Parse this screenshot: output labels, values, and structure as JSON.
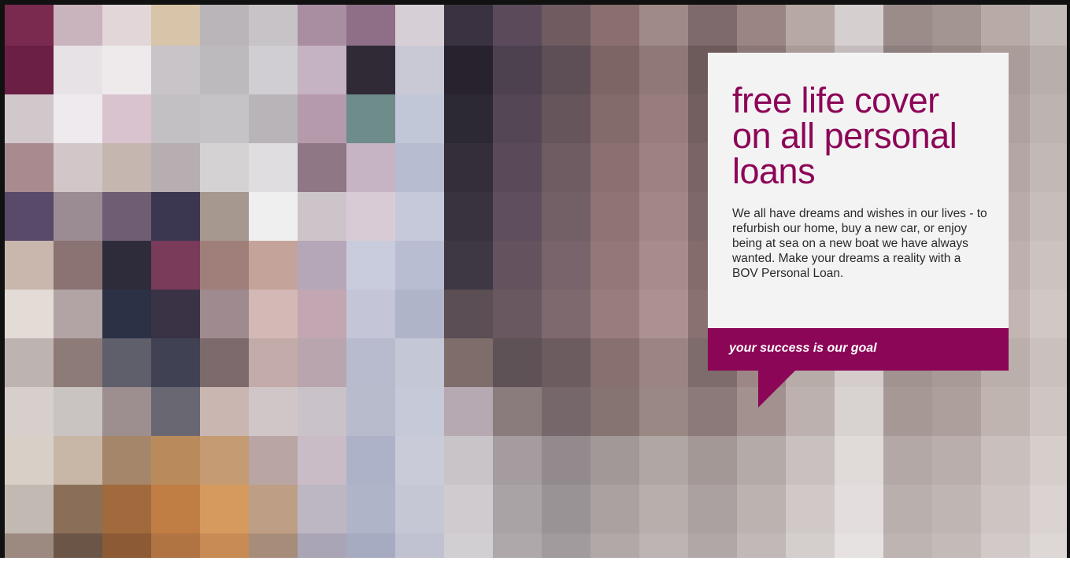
{
  "promo": {
    "headline": "free life cover on all personal loans",
    "body": "We all have dreams and wishes in our lives - to refurbish our home, buy a new car, or enjoy being at sea on a new boat we have always wanted. Make your dreams a reality with a BOV Personal Loan.",
    "tagline": "your success is our goal"
  },
  "colors": {
    "brand": "#8c0657",
    "card_background": "#f4f3f4",
    "body_text": "#2b2b2b",
    "tagline_text": "#ffffff"
  }
}
